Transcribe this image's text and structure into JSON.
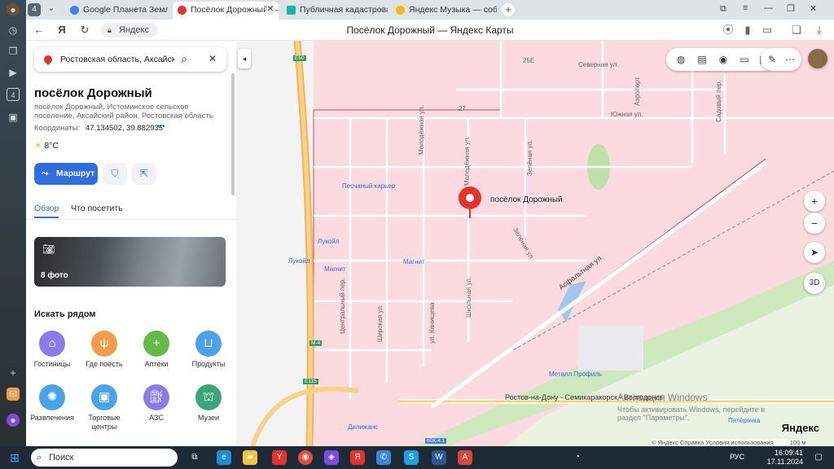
{
  "browser": {
    "tabs": [
      {
        "label": "Google Планета Земля",
        "favicon_color": "#3b82f6"
      },
      {
        "label": "Посёлок Дорожный —",
        "favicon_color": "#e5322d"
      },
      {
        "label": "Публичная кадастровая",
        "favicon_color": "#14b8a6"
      },
      {
        "label": "Яндекс Музыка — собир",
        "favicon_color": "#f5b800"
      }
    ],
    "tab_count_badge": "4",
    "address_text": "Яндекс",
    "page_title": "Посёлок Дорожный — Яндекс Карты"
  },
  "sidebar": {
    "search_value": "Ростовская область, Аксайский",
    "place_title": "посёлок Дорожный",
    "place_description": "посёлок Дорожный, Истоминское сельское поселение, Аксайский район, Ростовская область",
    "coords_label": "Координаты:",
    "coords_value": "47.134502, 39.882935",
    "weather": "8°C",
    "route_button": "Маршрут",
    "tabs": {
      "overview": "Обзор",
      "visit": "Что посетить"
    },
    "photo_count": "8 фото",
    "nearby_title": "Искать рядом",
    "categories": [
      {
        "label": "Гостиницы",
        "color": "#8b7be8",
        "icon": "bed-icon"
      },
      {
        "label": "Где поесть",
        "color": "#f39a4b",
        "icon": "fork-icon"
      },
      {
        "label": "Аптеки",
        "color": "#67b84a",
        "icon": "plus-icon"
      },
      {
        "label": "Продукты",
        "color": "#4aa3e8",
        "icon": "basket-icon"
      },
      {
        "label": "Развлечения",
        "color": "#4aa3e8",
        "icon": "wheel-icon"
      },
      {
        "label": "Торговые центры",
        "color": "#4aa3e8",
        "icon": "bag-icon"
      },
      {
        "label": "АЗС",
        "color": "#8b7be8",
        "icon": "fuel-icon"
      },
      {
        "label": "Музеи",
        "color": "#3ba57e",
        "icon": "museum-icon"
      }
    ]
  },
  "map": {
    "marker_label": "посёлок Дорожный",
    "labels": {
      "severnaya": "Северная ул.",
      "yuzhnaya": "Южная ул.",
      "peschany": "Песчаный карьер",
      "lukoil1": "Лукойл",
      "lukoil2": "Лукойл",
      "magnit1": "Магнит",
      "magnit2": "Магнит",
      "asfaltnaya": "Асфальтная ул.",
      "rostov_road": "Ростов-на-Дону - Семикаракорск - Волгодонск",
      "metall": "Металл Профиль",
      "dilijans": "Дилижанс",
      "pyaterochka": "Пятёрочка",
      "centralny": "Центральный пер.",
      "shirokaya": "Широкая ул.",
      "kanischeva": "ул. Канищева",
      "shkolnaya": "Школьная ул.",
      "molodezhnaya": "Молодёжная ул.",
      "molodezhnaya2": "Молодёжная ул.",
      "zelenaya": "Зелёная ул.",
      "zelenaya2": "Зелёная ул.",
      "aeroport": "Аэропорт",
      "sadovy": "Садовый пер.",
      "road_e50": "E50",
      "road_m4": "M-4",
      "road_e115": "E115",
      "road_60k": "60К-4.1",
      "house_25e": "25E",
      "house_27": "27"
    },
    "activation_title": "Активация Windows",
    "activation_sub": "Чтобы активировать Windows, перейдите в раздел \"Параметры\".",
    "logo": "Яндекс",
    "footer": "© Яндекс   Справка   Условия использования",
    "scale": "100 м",
    "control_3d": "3D"
  },
  "taskbar": {
    "search_placeholder": "Поиск",
    "lang": "РУС",
    "time": "16:09:41",
    "date": "17.11.2024"
  }
}
